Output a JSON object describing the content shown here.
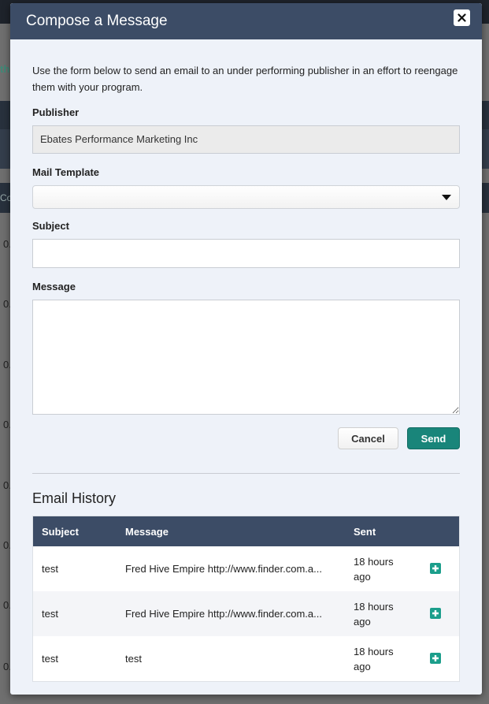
{
  "background": {
    "fragment": "th",
    "fragment2": "Co",
    "row_numbers": [
      "0.",
      "0.",
      "0.",
      "0.",
      "0.",
      "0.",
      "0.",
      "0."
    ]
  },
  "modal": {
    "title": "Compose a Message",
    "close_label": "×",
    "intro": "Use the form below to send an email to an under performing publisher in an effort to reengage them with your program.",
    "publisher": {
      "label": "Publisher",
      "value": "Ebates Performance Marketing Inc"
    },
    "mail_template": {
      "label": "Mail Template",
      "value": ""
    },
    "subject": {
      "label": "Subject",
      "value": ""
    },
    "message": {
      "label": "Message",
      "value": ""
    },
    "buttons": {
      "cancel": "Cancel",
      "send": "Send"
    }
  },
  "history": {
    "title": "Email History",
    "columns": {
      "subject": "Subject",
      "message": "Message",
      "sent": "Sent"
    },
    "rows": [
      {
        "subject": "test",
        "message": "Fred Hive Empire http://www.finder.com.a...",
        "sent": "18 hours ago"
      },
      {
        "subject": "test",
        "message": "Fred Hive Empire http://www.finder.com.a...",
        "sent": "18 hours ago"
      },
      {
        "subject": "test",
        "message": "test",
        "sent": "18 hours ago"
      }
    ]
  },
  "colors": {
    "header": "#3c4c66",
    "accent": "#19857a",
    "plus_icon": "#1b9e8b",
    "modal_bg": "#eef2f9"
  },
  "icons": {
    "close": "close-icon",
    "dropdown": "chevron-down-icon",
    "expand": "plus-icon"
  }
}
